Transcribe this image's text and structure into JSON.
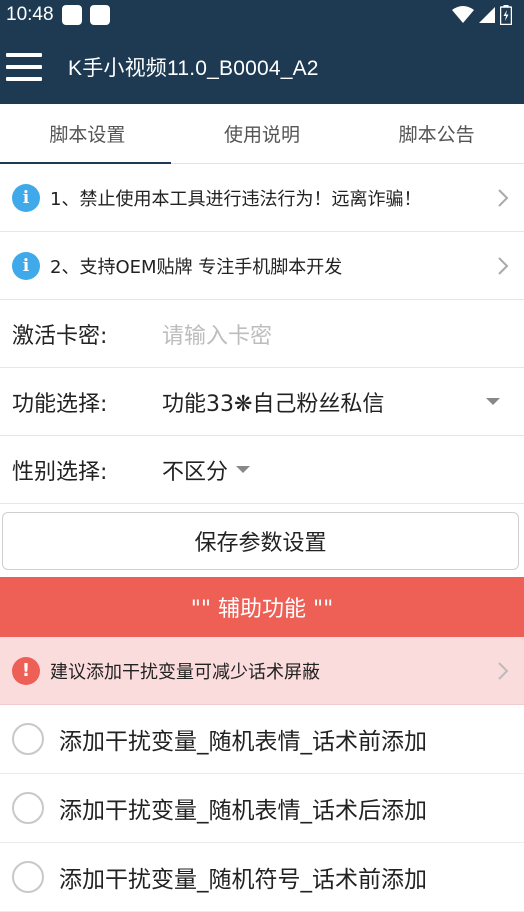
{
  "status_bar": {
    "time": "10:48"
  },
  "app_bar": {
    "title": "K手小视频11.0_B0004_A2"
  },
  "tabs": [
    {
      "label": "脚本设置"
    },
    {
      "label": "使用说明"
    },
    {
      "label": "脚本公告"
    }
  ],
  "notices": [
    {
      "text": "1、禁止使用本工具进行违法行为！远离诈骗！"
    },
    {
      "text": "2、支持OEM贴牌 专注手机脚本开发"
    }
  ],
  "form": {
    "activation": {
      "label": "激活卡密:",
      "placeholder": "请输入卡密"
    },
    "function": {
      "label": "功能选择:",
      "value": "功能33❋自己粉丝私信"
    },
    "gender": {
      "label": "性别选择:",
      "value": "不区分"
    }
  },
  "save_button": {
    "label": "保存参数设置"
  },
  "aux_banner": {
    "label": "\"\" 辅助功能 \"\""
  },
  "warning": {
    "text": "建议添加干扰变量可减少话术屏蔽"
  },
  "options": [
    {
      "label": "添加干扰变量_随机表情_话术前添加"
    },
    {
      "label": "添加干扰变量_随机表情_话术后添加"
    },
    {
      "label": "添加干扰变量_随机符号_话术前添加"
    }
  ],
  "colors": {
    "primary": "#1d3a52",
    "accent_red": "#ee5f55",
    "info_blue": "#3fa9ea",
    "warning_bg": "#fbdcdc"
  }
}
